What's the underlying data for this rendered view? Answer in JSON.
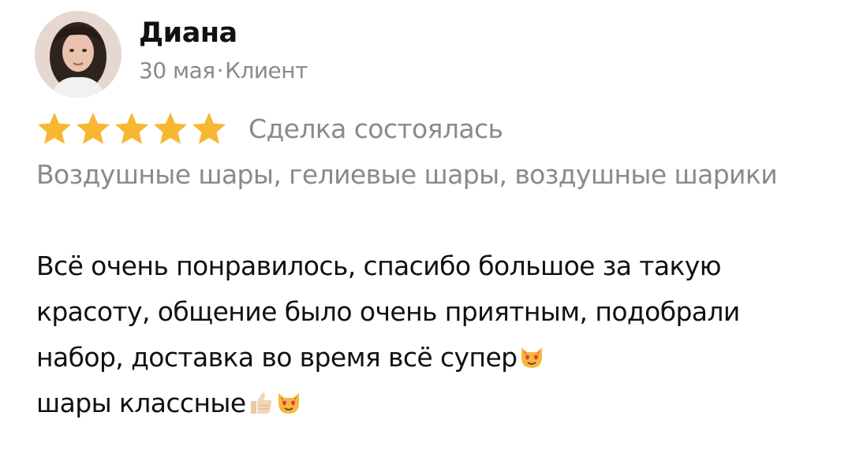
{
  "review": {
    "author_name": "Диана",
    "date": "30 мая",
    "separator": "·",
    "role": "Клиент",
    "rating": 5,
    "rating_max": 5,
    "deal_status": "Сделка состоялась",
    "category": "Воздушные шары, гелиевые шары, воздушные шарики",
    "text_part1": "Всё очень понравилось, спасибо большое за такую красоту, общение было очень приятным, подобрали набор, доставка во время всё супер",
    "text_part2": "шары классные",
    "emojis": [
      "heart-eyes-cat",
      "thumbs-up",
      "heart-eyes-cat"
    ]
  },
  "colors": {
    "star": "#F7B731",
    "primary_text": "#111111",
    "secondary_text": "#8A8A8A"
  }
}
